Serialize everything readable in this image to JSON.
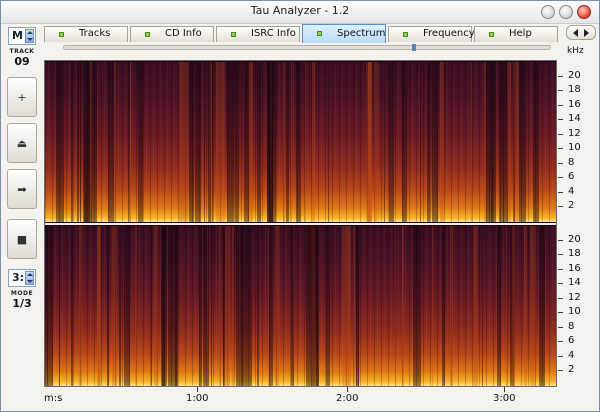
{
  "window": {
    "title": "Tau Analyzer - 1.2"
  },
  "sidebar": {
    "mode_select": "M",
    "track_label": "TRACK",
    "track_number": "09",
    "buttons": [
      {
        "name": "add-button",
        "glyph": "+"
      },
      {
        "name": "eject-button",
        "glyph": "⏏"
      },
      {
        "name": "next-button",
        "glyph": "➡"
      },
      {
        "name": "stop-button",
        "glyph": "■"
      }
    ],
    "channel_select": "3:",
    "mode_label": "MODE",
    "mode_value": "1/3"
  },
  "tabs": [
    {
      "label": "Tracks",
      "active": false
    },
    {
      "label": "CD Info",
      "active": false
    },
    {
      "label": "ISRC Info",
      "active": false
    },
    {
      "label": "Spectrum",
      "active": true
    },
    {
      "label": "Frequency",
      "active": false
    },
    {
      "label": "Help",
      "active": false
    }
  ],
  "spectrogram": {
    "unit_label": "kHz",
    "freq_ticks": [
      "20",
      "18",
      "16",
      "14",
      "12",
      "10",
      "8",
      "6",
      "4",
      "2"
    ],
    "time_axis_label": "m:s",
    "time_ticks": [
      "1:00",
      "2:00",
      "3:00"
    ],
    "scroll_position": 0.72
  },
  "colors": {
    "accent_tab": "#b9dcfb",
    "spectrum_hot": "#ffe18a",
    "spectrum_cold": "#3a0d22"
  }
}
